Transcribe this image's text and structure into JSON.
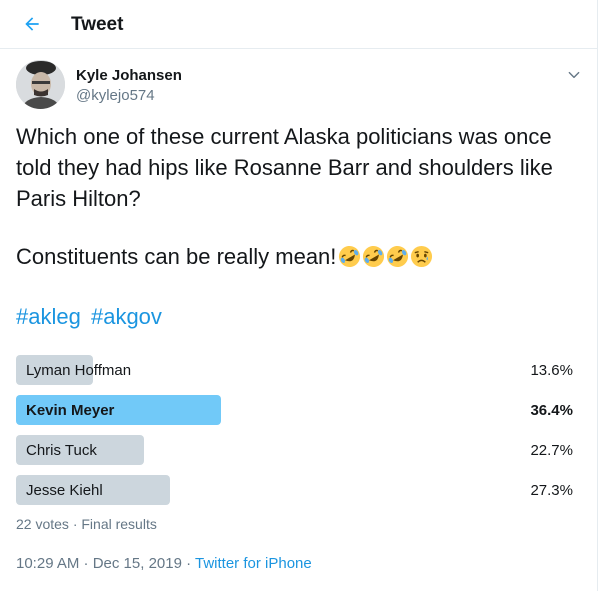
{
  "header": {
    "title": "Tweet",
    "back_icon": "arrow-left-icon",
    "accent": "#1da1f2"
  },
  "author": {
    "name": "Kyle Johansen",
    "handle": "@kylejo574",
    "avatar_icon": "user-avatar"
  },
  "tweet": {
    "text": "Which one of these current Alaska politicians was once told they had hips like Rosanne Barr and shoulders like Paris Hilton?",
    "text2": "Constituents can be really mean!",
    "emojis": [
      "rolling-on-floor-laughing-emoji",
      "rolling-on-floor-laughing-emoji",
      "rolling-on-floor-laughing-emoji",
      "sad-relieved-face-emoji"
    ],
    "hashtags": [
      "#akleg",
      "#akgov"
    ]
  },
  "poll": {
    "options": [
      {
        "label": "Lyman Hoffman",
        "percent_text": "13.6%",
        "percent": 13.6,
        "winner": false
      },
      {
        "label": "Kevin Meyer",
        "percent_text": "36.4%",
        "percent": 36.4,
        "winner": true
      },
      {
        "label": "Chris Tuck",
        "percent_text": "22.7%",
        "percent": 22.7,
        "winner": false
      },
      {
        "label": "Jesse Kiehl",
        "percent_text": "27.3%",
        "percent": 27.3,
        "winner": false
      }
    ],
    "meta": "22 votes · Final results",
    "bar_color": "#ccd6dd",
    "winner_color": "#71c9f8"
  },
  "footer": {
    "timestamp": "10:29 AM · Dec 15, 2019 · ",
    "source": "Twitter for iPhone"
  }
}
